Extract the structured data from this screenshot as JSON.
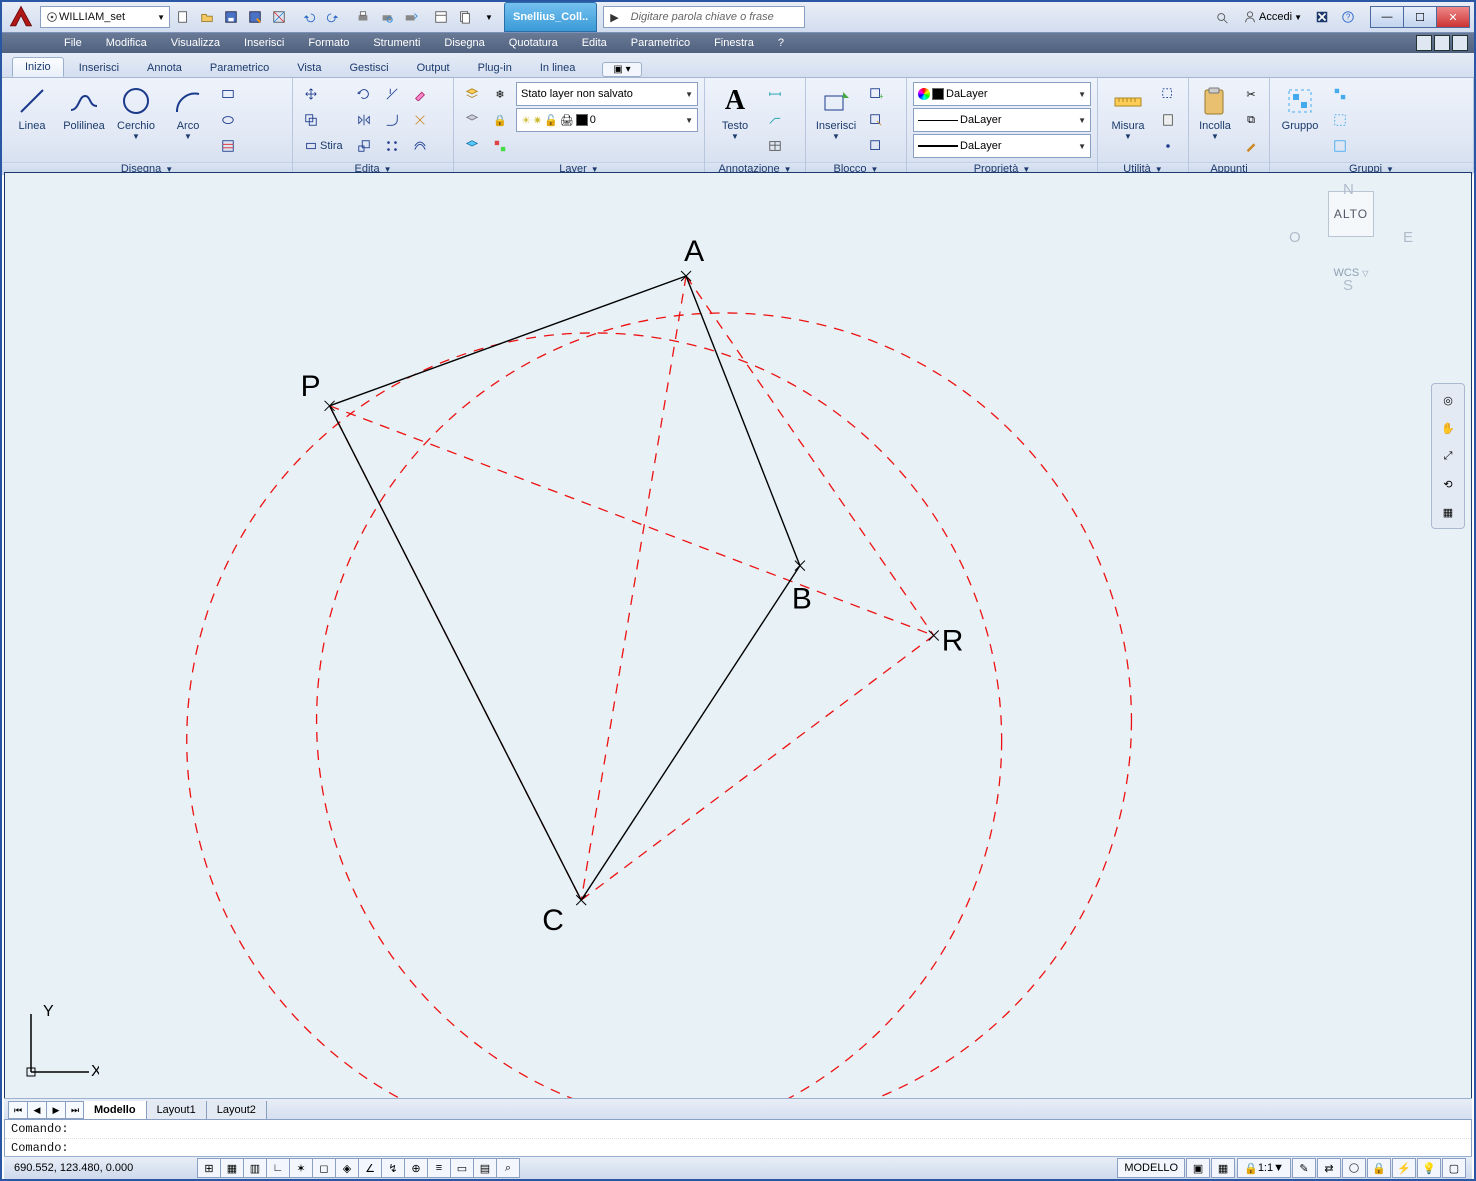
{
  "app": {
    "workspace_label": "WILLIAM_set",
    "doc_tab": "Snellius_Coll..",
    "search_placeholder": "Digitare parola chiave o frase",
    "signin": "Accedi"
  },
  "menu": [
    "File",
    "Modifica",
    "Visualizza",
    "Inserisci",
    "Formato",
    "Strumenti",
    "Disegna",
    "Quotatura",
    "Edita",
    "Parametrico",
    "Finestra",
    "?"
  ],
  "ribbon_tabs": [
    "Inizio",
    "Inserisci",
    "Annota",
    "Parametrico",
    "Vista",
    "Gestisci",
    "Output",
    "Plug-in",
    "In linea"
  ],
  "panels": {
    "disegna": {
      "title": "Disegna",
      "linea": "Linea",
      "polilinea": "Polilinea",
      "cerchio": "Cerchio",
      "arco": "Arco"
    },
    "edita": {
      "title": "Edita",
      "stira": "Stira"
    },
    "layer": {
      "title": "Layer",
      "state": "Stato layer non salvato",
      "current": "0"
    },
    "annot": {
      "title": "Annotazione",
      "testo": "Testo"
    },
    "blocco": {
      "title": "Blocco",
      "inserisci": "Inserisci"
    },
    "props": {
      "title": "Proprietà",
      "bylayer": "DaLayer",
      "bylayer2": "DaLayer",
      "bylayer3": "DaLayer"
    },
    "util": {
      "title": "Utilità",
      "misura": "Misura"
    },
    "appunti": {
      "title": "Appunti",
      "incolla": "Incolla"
    },
    "gruppi": {
      "title": "Gruppi",
      "gruppo": "Gruppo"
    }
  },
  "viewcube": {
    "top": "ALTO",
    "n": "N",
    "s": "S",
    "e": "E",
    "o": "O",
    "wcs": "WCS"
  },
  "drawing": {
    "labels": {
      "A": "A",
      "B": "B",
      "C": "C",
      "P": "P",
      "R": "R"
    },
    "ucs": {
      "x": "X",
      "y": "Y"
    }
  },
  "model_tabs": {
    "model": "Modello",
    "l1": "Layout1",
    "l2": "Layout2"
  },
  "command": {
    "prompt": "Comando:"
  },
  "status": {
    "coords": "690.552, 123.480, 0.000",
    "model": "MODELLO",
    "scale": "1:1"
  }
}
